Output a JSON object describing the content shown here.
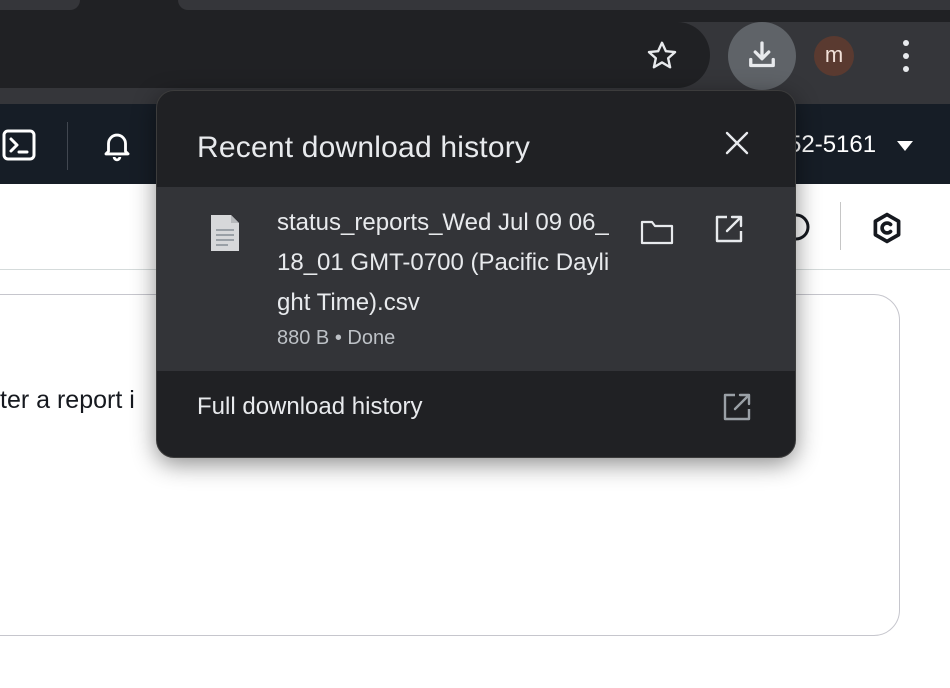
{
  "browser": {
    "avatar_initial": "m",
    "icons": {
      "bookmark": "star-icon",
      "downloads": "download-icon",
      "menu": "kebab-menu-icon"
    }
  },
  "app_nav": {
    "account_suffix": "52-5161",
    "icons": {
      "console": "cloudshell-console-icon",
      "notifications": "bell-icon",
      "account_menu": "caret-down-icon"
    }
  },
  "content": {
    "partial_text": "ter a report i"
  },
  "download_popup": {
    "title": "Recent download history",
    "item": {
      "filename": "status_reports_Wed Jul 09 06_18_01 GMT-0700 (Pacific Daylight Time).csv",
      "status": "880 B • Done"
    },
    "full_history_label": "Full download history"
  },
  "colors": {
    "toolbar_bg": "#35363a",
    "popup_bg": "#202124",
    "popup_item_bg": "#333438",
    "app_nav_bg": "#161d26"
  }
}
